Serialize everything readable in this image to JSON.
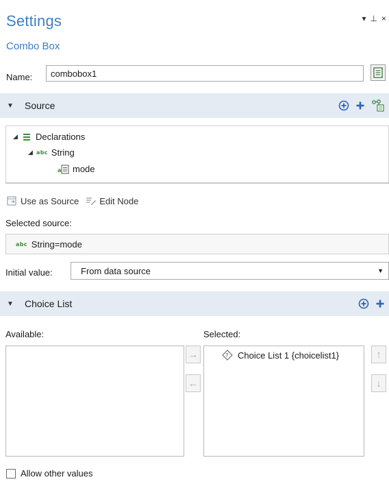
{
  "header": {
    "title": "Settings",
    "subtitle": "Combo Box",
    "controls": [
      "▾",
      "⊥",
      "×"
    ]
  },
  "name": {
    "label": "Name:",
    "value": "combobox1"
  },
  "source_section": {
    "title": "Source",
    "icons": [
      "add-circle-icon",
      "add-icon",
      "tree-node-icon"
    ]
  },
  "tree": {
    "root": "Declarations",
    "child": "String",
    "leaf": "mode",
    "type_badge": "abc"
  },
  "toolbar": {
    "use_as_source": "Use as Source",
    "edit_node": "Edit Node"
  },
  "selected_source": {
    "label": "Selected source:",
    "badge": "abc",
    "value": "String=mode"
  },
  "initial_value": {
    "label": "Initial value:",
    "selected": "From data source"
  },
  "choice_list_section": {
    "title": "Choice List",
    "icons": [
      "add-circle-icon",
      "add-icon"
    ]
  },
  "lists": {
    "available_label": "Available:",
    "selected_label": "Selected:",
    "selected_items": [
      "Choice List 1 {choicelist1}"
    ]
  },
  "allow_other": {
    "label": "Allow other values",
    "checked": false
  },
  "colors": {
    "title_blue": "#3b7fc4",
    "section_bg": "#e4ebf3",
    "icon_blue": "#2b63b8",
    "icon_green": "#3d8a3d"
  }
}
